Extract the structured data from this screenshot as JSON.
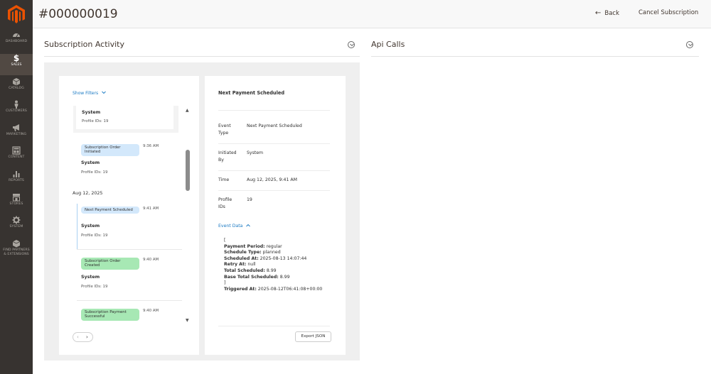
{
  "header": {
    "title": "#000000019",
    "back_label": "Back",
    "cancel_label": "Cancel Subscription"
  },
  "sidebar": {
    "items": [
      {
        "label": "DASHBOARD",
        "icon": "dashboard-icon"
      },
      {
        "label": "SALES",
        "icon": "dollar-icon",
        "active": true
      },
      {
        "label": "CATALOG",
        "icon": "box-icon"
      },
      {
        "label": "CUSTOMERS",
        "icon": "person-icon"
      },
      {
        "label": "MARKETING",
        "icon": "megaphone-icon"
      },
      {
        "label": "CONTENT",
        "icon": "layout-icon"
      },
      {
        "label": "REPORTS",
        "icon": "bar-chart-icon"
      },
      {
        "label": "STORES",
        "icon": "store-icon"
      },
      {
        "label": "SYSTEM",
        "icon": "gear-icon"
      },
      {
        "label": "FIND PARTNERS",
        "label2": "& EXTENSIONS",
        "icon": "puzzle-box-icon"
      }
    ]
  },
  "activity": {
    "title": "Subscription Activity",
    "show_filters": "Show Filters",
    "events": [
      {
        "title": "System",
        "sub": "Profile IDs: 19"
      },
      {
        "badge": "Subscription Order Initiated",
        "badge_color": "#d3e8fb",
        "time": "9:36 AM",
        "title": "System",
        "sub": "Profile IDs: 19"
      },
      {
        "date": "Aug 12, 2025"
      },
      {
        "badge": "Next Payment Scheduled",
        "badge_color": "#d3e8fb",
        "time": "9:41 AM",
        "title": "System",
        "sub": "Profile IDs: 19",
        "selected": true
      },
      {
        "badge": "Subscription Order Created",
        "badge_color": "#a7e8b4",
        "time": "9:40 AM",
        "title": "System",
        "sub": "Profile IDs: 19"
      },
      {
        "badge": "Subscription Payment Successful",
        "badge_color": "#a7e8b4",
        "time": "9:40 AM"
      }
    ]
  },
  "detail": {
    "title": "Next Payment Scheduled",
    "rows": [
      {
        "key": "Event Type",
        "value": "Next Payment Scheduled"
      },
      {
        "key": "Initiated By",
        "value": "System"
      },
      {
        "key": "Time",
        "value": "Aug 12, 2025, 9:41 AM"
      },
      {
        "key": "Profile IDs",
        "value": "19"
      }
    ],
    "event_data_label": "Event Data",
    "json_open": "[",
    "json_close": "]",
    "json": [
      {
        "k": "Payment Period:",
        "v": "regular"
      },
      {
        "k": "Schedule Type:",
        "v": "planned"
      },
      {
        "k": "Scheduled At:",
        "v": "2025-08-13 14:07:44"
      },
      {
        "k": "Retry At:",
        "v": "null"
      },
      {
        "k": "Total Scheduled:",
        "v": "8.99"
      },
      {
        "k": "Base Total Scheduled:",
        "v": "8.99"
      }
    ],
    "triggered": {
      "k": "Triggered At:",
      "v": "2025-08-12T06:41:08+00:00"
    },
    "export_label": "Export JSON"
  },
  "api": {
    "title": "Api Calls"
  },
  "colors": {
    "sidebar_bg": "#373330",
    "sidebar_active": "#514943",
    "logo": "#eb5202",
    "link": "#1979c3",
    "badge_blue": "#d3e8fb",
    "badge_green": "#a7e8b4"
  }
}
